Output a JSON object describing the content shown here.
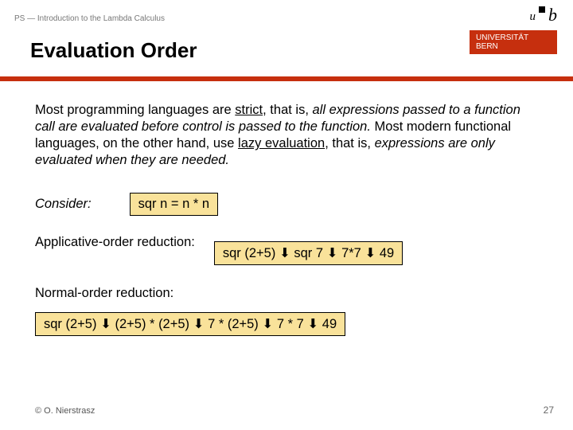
{
  "header": {
    "course": "PS — Introduction to the Lambda Calculus"
  },
  "logo": {
    "u": "u",
    "b": "b",
    "line1": "UNIVERSITÄT",
    "line2": "BERN"
  },
  "title": "Evaluation Order",
  "para": {
    "seg1": "Most programming languages are ",
    "strict": "strict",
    "seg2": ", that is, ",
    "em1": "all expressions passed to a function call are evaluated before control is passed to the function.",
    "seg3": " Most modern functional languages, on the other hand, use ",
    "lazy": "lazy evaluation",
    "seg4": ", that is, ",
    "em2": "expressions are only evaluated when they are needed."
  },
  "consider": {
    "label": "Consider:",
    "code": "sqr n = n * n"
  },
  "arrow": "⬇",
  "applicative": {
    "label": "Applicative-order reduction:",
    "s1": "sqr (2+5)",
    "s2": "sqr 7",
    "s3": "7*7",
    "s4": "49"
  },
  "normal": {
    "label": "Normal-order reduction:",
    "s1": "sqr (2+5)",
    "s2": "(2+5) * (2+5)",
    "s3": "7 * (2+5)",
    "s4": "7 * 7",
    "s5": "49"
  },
  "footer": {
    "copyright": "© O. Nierstrasz",
    "page": "27"
  }
}
